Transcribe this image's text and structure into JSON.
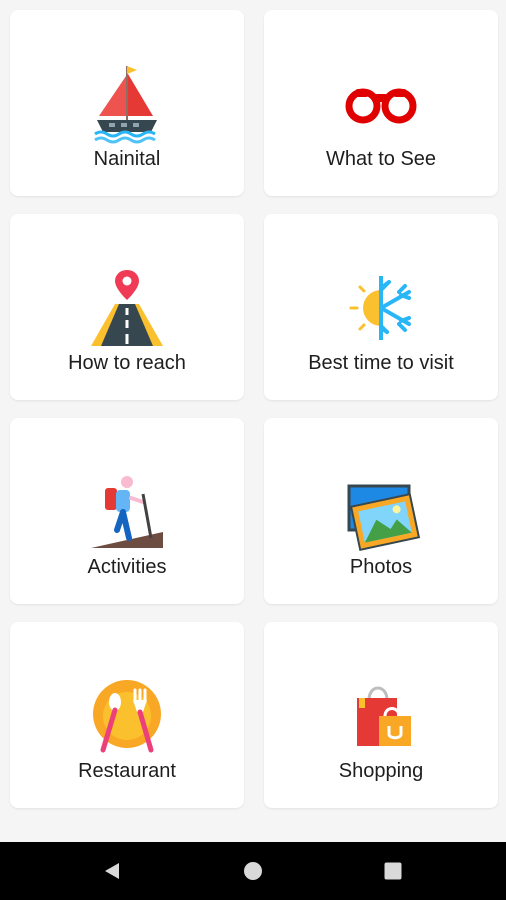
{
  "tiles": [
    {
      "label": "Nainital",
      "icon": "sailboat-icon"
    },
    {
      "label": "What to See",
      "icon": "binoculars-icon"
    },
    {
      "label": "How to reach",
      "icon": "road-pin-icon"
    },
    {
      "label": "Best time to visit",
      "icon": "sun-snowflake-icon"
    },
    {
      "label": "Activities",
      "icon": "hiker-icon"
    },
    {
      "label": "Photos",
      "icon": "photos-icon"
    },
    {
      "label": "Restaurant",
      "icon": "plate-cutlery-icon"
    },
    {
      "label": "Shopping",
      "icon": "shopping-bags-icon"
    }
  ],
  "navbar": {
    "back": "back-triangle-icon",
    "home": "home-circle-icon",
    "recents": "recents-square-icon"
  },
  "colors": {
    "background": "#f5f5f5",
    "card": "#ffffff",
    "label_text": "#1e1e1e",
    "navbar": "#000000",
    "accent_red": "#e53935",
    "accent_yellow": "#fbc02d",
    "accent_blue": "#29b6f6"
  }
}
